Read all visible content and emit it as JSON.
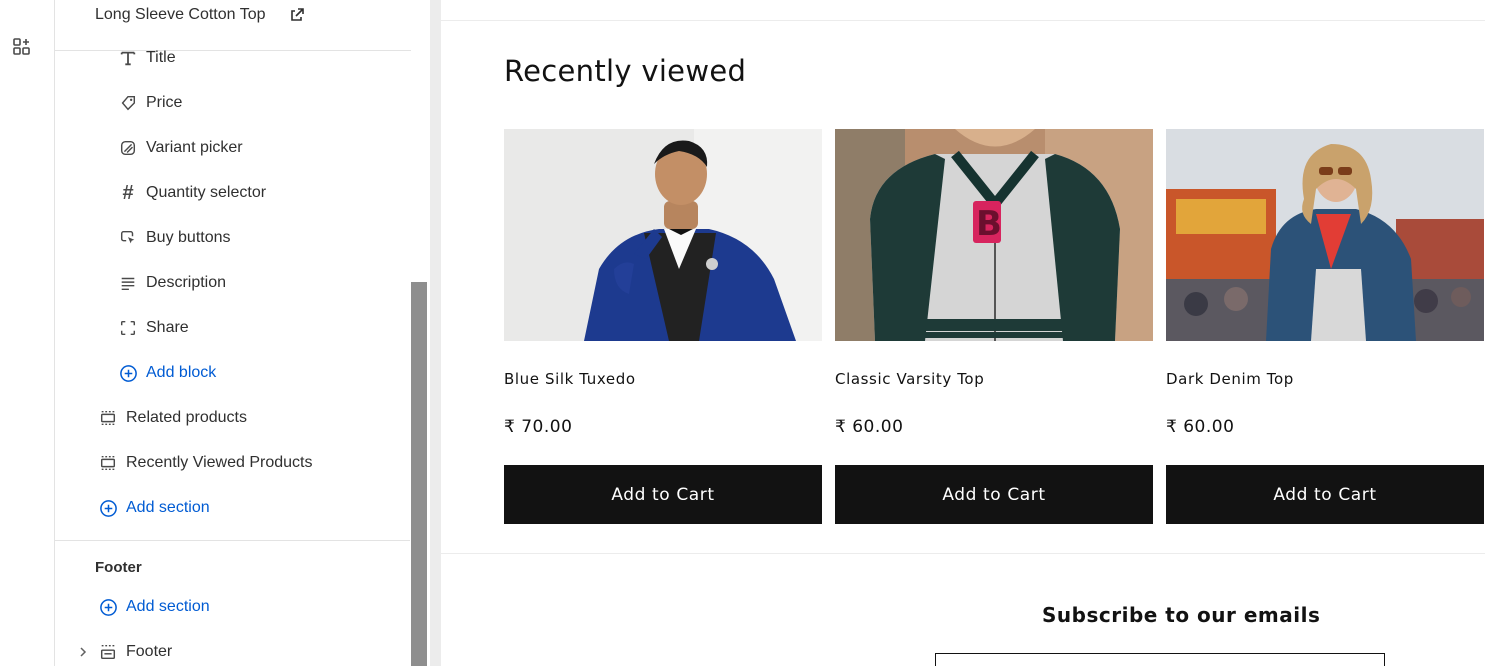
{
  "sidebar": {
    "template_title": "Long Sleeve Cotton Top",
    "blocks": [
      {
        "label": "Title",
        "icon": "title-icon"
      },
      {
        "label": "Price",
        "icon": "price-tag-icon"
      },
      {
        "label": "Variant picker",
        "icon": "variant-icon"
      },
      {
        "label": "Quantity selector",
        "icon": "hash-icon"
      },
      {
        "label": "Buy buttons",
        "icon": "cursor-click-icon"
      },
      {
        "label": "Description",
        "icon": "text-align-icon"
      },
      {
        "label": "Share",
        "icon": "share-frame-icon"
      }
    ],
    "add_block_label": "Add block",
    "sections": [
      {
        "label": "Related products",
        "icon": "section-icon"
      },
      {
        "label": "Recently Viewed Products",
        "icon": "section-icon"
      }
    ],
    "add_section_label": "Add section",
    "footer_group_title": "Footer",
    "footer_add_section_label": "Add section",
    "footer_section_label": "Footer"
  },
  "preview": {
    "section_title": "Recently viewed",
    "products": [
      {
        "name": "Blue Silk Tuxedo",
        "price": "₹ 70.00",
        "button": "Add to Cart"
      },
      {
        "name": "Classic Varsity Top",
        "price": "₹ 60.00",
        "button": "Add to Cart"
      },
      {
        "name": "Dark Denim Top",
        "price": "₹ 60.00",
        "button": "Add to Cart"
      }
    ],
    "subscribe_title": "Subscribe to our emails"
  },
  "colors": {
    "accent_blue": "#005bd3",
    "button_black": "#121212"
  }
}
